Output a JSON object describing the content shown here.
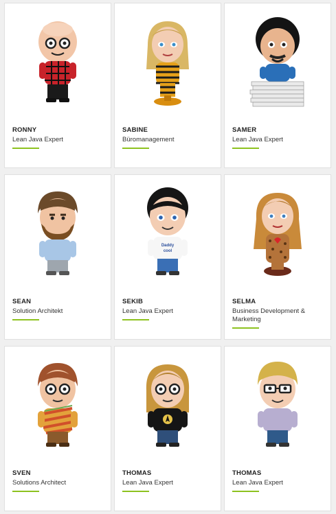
{
  "accent_color": "#8dc21f",
  "team": [
    {
      "name": "RONNY",
      "role": "Lean Java Expert",
      "avatar": "bald-glasses-plaid-avatar"
    },
    {
      "name": "SABINE",
      "role": "Büromanagement",
      "avatar": "blonde-bee-stripes-avatar"
    },
    {
      "name": "SAMER",
      "role": "Lean Java Expert",
      "avatar": "curly-black-hair-paper-stack-avatar"
    },
    {
      "name": "SEAN",
      "role": "Solution Architekt",
      "avatar": "bearded-brown-hair-avatar"
    },
    {
      "name": "SEKIB",
      "role": "Lean Java Expert",
      "avatar": "black-hair-daddy-cool-shirt-avatar"
    },
    {
      "name": "SELMA",
      "role": "Business Development & Marketing",
      "avatar": "red-hair-leopard-dress-avatar"
    },
    {
      "name": "SVEN",
      "role": "Solutions Architect",
      "avatar": "auburn-hair-striped-shirt-avatar"
    },
    {
      "name": "THOMAS",
      "role": "Lean Java Expert",
      "avatar": "long-blonde-hair-glasses-avatar"
    },
    {
      "name": "THOMAS",
      "role": "Lean Java Expert",
      "avatar": "blonde-hair-black-glasses-avatar"
    }
  ]
}
